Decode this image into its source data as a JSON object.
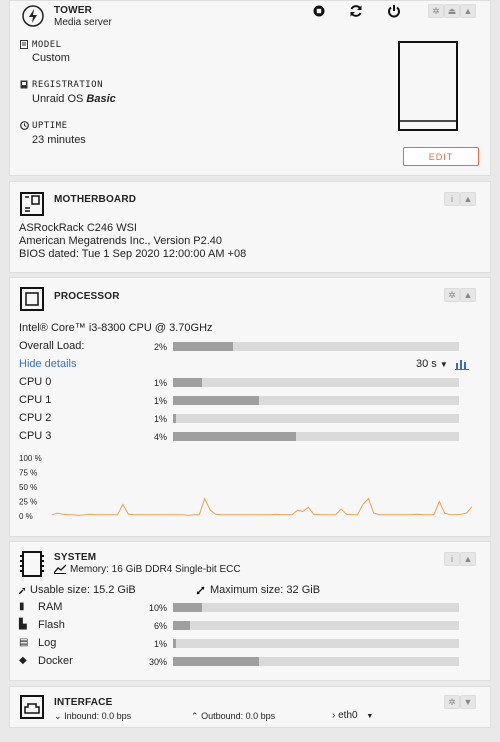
{
  "tower": {
    "title": "TOWER",
    "subtitle": "Media server",
    "model_label": "MODEL",
    "model_value": "Custom",
    "registration_label": "REGISTRATION",
    "registration_prefix": "Unraid OS",
    "registration_value": "Basic",
    "uptime_label": "UPTIME",
    "uptime_value": "23 minutes",
    "edit_label": "EDIT"
  },
  "motherboard": {
    "title": "MOTHERBOARD",
    "line1": "ASRockRack C246 WSI",
    "line2": "American Megatrends Inc., Version P2.40",
    "line3": "BIOS dated: Tue 1 Sep 2020 12:00:00 AM +08"
  },
  "processor": {
    "title": "PROCESSOR",
    "model": "Intel® Core™ i3-8300 CPU @ 3.70GHz",
    "overall_label": "Overall Load:",
    "overall_pct": "2%",
    "overall_value": 0.21,
    "hide_details": "Hide details",
    "interval": "30 s",
    "cpus": [
      {
        "label": "CPU 0",
        "pct": "1%",
        "value": 0.1
      },
      {
        "label": "CPU 1",
        "pct": "1%",
        "value": 0.3
      },
      {
        "label": "CPU 2",
        "pct": "1%",
        "value": 0.01
      },
      {
        "label": "CPU 3",
        "pct": "4%",
        "value": 0.43
      }
    ],
    "graph_ticks": [
      "100 %",
      "75 %",
      "50 %",
      "25 %",
      "0 %"
    ],
    "graph_color": "#f0a04b"
  },
  "chart_data": {
    "type": "line",
    "ylim": [
      0,
      100
    ],
    "yticks": [
      "100 %",
      "75 %",
      "50 %",
      "25 %",
      "0 %"
    ],
    "series": [
      {
        "values": [
          2,
          5,
          3,
          2,
          2,
          1,
          2,
          3,
          2,
          2,
          2,
          2,
          2,
          20,
          3,
          2,
          2,
          2,
          2,
          2,
          2,
          2,
          2,
          2,
          2,
          1,
          2,
          2,
          30,
          10,
          3,
          2,
          2,
          2,
          2,
          2,
          2,
          2,
          2,
          2,
          2,
          3,
          2,
          2,
          2,
          10,
          8,
          15,
          3,
          2,
          2,
          2,
          2,
          12,
          3,
          2,
          2,
          20,
          30,
          5,
          2,
          2,
          2,
          2,
          2,
          2,
          2,
          3,
          2,
          2,
          2,
          25,
          5,
          2,
          2,
          3,
          5,
          16
        ]
      }
    ]
  },
  "system": {
    "title": "SYSTEM",
    "memory": "Memory: 16 GiB DDR4 Single-bit ECC",
    "usable": "Usable size: 15.2 GiB",
    "maximum": "Maximum size: 32 GiB",
    "items": [
      {
        "label": "RAM",
        "pct": "10%",
        "value": 0.1
      },
      {
        "label": "Flash",
        "pct": "6%",
        "value": 0.06
      },
      {
        "label": "Log",
        "pct": "1%",
        "value": 0.01
      },
      {
        "label": "Docker",
        "pct": "30%",
        "value": 0.3
      }
    ]
  },
  "interface": {
    "title": "INTERFACE",
    "inbound": "Inbound: 0.0 bps",
    "outbound": "Outbound: 0.0 bps",
    "iface": "eth0"
  }
}
